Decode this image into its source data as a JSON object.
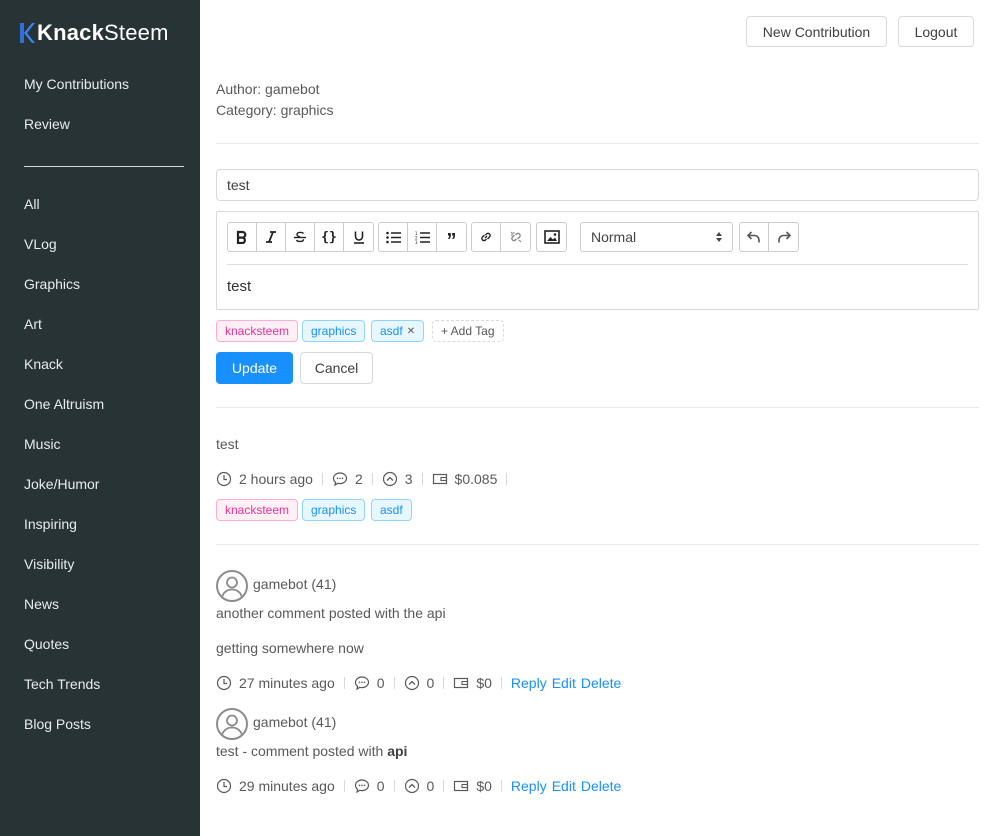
{
  "brand": {
    "part1": "Knack",
    "part2": "Steem"
  },
  "sidebar": {
    "top_items": [
      "My Contributions",
      "Review"
    ],
    "categories": [
      "All",
      "VLog",
      "Graphics",
      "Art",
      "Knack",
      "One Altruism",
      "Music",
      "Joke/Humor",
      "Inspiring",
      "Visibility",
      "News",
      "Quotes",
      "Tech Trends",
      "Blog Posts"
    ]
  },
  "header": {
    "new_contribution": "New Contribution",
    "logout": "Logout"
  },
  "post_meta": {
    "author": "Author: gamebot",
    "category": "Category: graphics"
  },
  "form": {
    "title_value": "test",
    "toolbar": {
      "format_select": "Normal",
      "icons": [
        "bold-icon",
        "italic-icon",
        "strike-icon",
        "code-block-icon",
        "underline-icon",
        "bullet-list-icon",
        "ordered-list-icon",
        "blockquote-icon",
        "link-icon",
        "unlink-icon",
        "image-icon",
        "undo-icon",
        "redo-icon"
      ]
    },
    "body_text": "test",
    "tags": [
      {
        "label": "knacksteem",
        "color": "magenta"
      },
      {
        "label": "graphics",
        "color": "blue"
      },
      {
        "label": "asdf",
        "color": "blue",
        "closable": true
      }
    ],
    "close_glyph": "✕",
    "add_tag": "+ Add Tag",
    "update": "Update",
    "cancel": "Cancel"
  },
  "post": {
    "body": "test",
    "time": "2 hours ago",
    "comments": "2",
    "votes": "3",
    "payout": "$0.085",
    "tags": [
      "knacksteem",
      "graphics",
      "asdf"
    ]
  },
  "comments": [
    {
      "author": "gamebot (41)",
      "lines": [
        "another comment posted with the api",
        "getting somewhere now"
      ],
      "time": "27 minutes ago",
      "comments": "0",
      "votes": "0",
      "payout": "$0",
      "actions": [
        "Reply",
        "Edit",
        "Delete"
      ]
    },
    {
      "author": "gamebot (41)",
      "text_prefix": "test - comment posted with ",
      "text_bold": "api",
      "time": "29 minutes ago",
      "comments": "0",
      "votes": "0",
      "payout": "$0",
      "actions": [
        "Reply",
        "Edit",
        "Delete"
      ]
    }
  ],
  "colors": {
    "sidebar_bg": "#283336",
    "primary": "#1890ff",
    "tag_magenta": "#eb2f96",
    "tag_blue": "#1890ff"
  }
}
